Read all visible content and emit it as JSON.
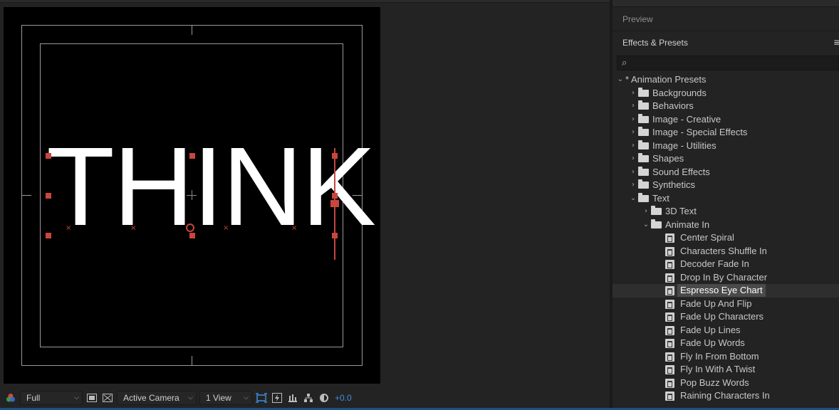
{
  "viewer": {
    "composition_text": "THINK",
    "toolbar": {
      "resolution": "Full",
      "camera": "Active Camera",
      "views": "1 View",
      "exposure": "+0.0"
    }
  },
  "panels": {
    "preview_title": "Preview",
    "effects_title": "Effects & Presets",
    "search_placeholder": ""
  },
  "tree": [
    {
      "label": "* Animation Presets",
      "kind": "root",
      "depth": 0,
      "expanded": true
    },
    {
      "label": "Backgrounds",
      "kind": "folder",
      "depth": 1,
      "expanded": false
    },
    {
      "label": "Behaviors",
      "kind": "folder",
      "depth": 1,
      "expanded": false
    },
    {
      "label": "Image - Creative",
      "kind": "folder",
      "depth": 1,
      "expanded": false
    },
    {
      "label": "Image - Special Effects",
      "kind": "folder",
      "depth": 1,
      "expanded": false
    },
    {
      "label": "Image - Utilities",
      "kind": "folder",
      "depth": 1,
      "expanded": false
    },
    {
      "label": "Shapes",
      "kind": "folder",
      "depth": 1,
      "expanded": false
    },
    {
      "label": "Sound Effects",
      "kind": "folder",
      "depth": 1,
      "expanded": false
    },
    {
      "label": "Synthetics",
      "kind": "folder",
      "depth": 1,
      "expanded": false
    },
    {
      "label": "Text",
      "kind": "folder",
      "depth": 1,
      "expanded": true
    },
    {
      "label": "3D Text",
      "kind": "folder",
      "depth": 2,
      "expanded": false
    },
    {
      "label": "Animate In",
      "kind": "folder",
      "depth": 2,
      "expanded": true
    },
    {
      "label": "Center Spiral",
      "kind": "preset",
      "depth": 3
    },
    {
      "label": "Characters Shuffle In",
      "kind": "preset",
      "depth": 3
    },
    {
      "label": "Decoder Fade In",
      "kind": "preset",
      "depth": 3
    },
    {
      "label": "Drop In By Character",
      "kind": "preset",
      "depth": 3
    },
    {
      "label": "Espresso Eye Chart",
      "kind": "preset",
      "depth": 3,
      "selected": true
    },
    {
      "label": "Fade Up And Flip",
      "kind": "preset",
      "depth": 3
    },
    {
      "label": "Fade Up Characters",
      "kind": "preset",
      "depth": 3
    },
    {
      "label": "Fade Up Lines",
      "kind": "preset",
      "depth": 3
    },
    {
      "label": "Fade Up Words",
      "kind": "preset",
      "depth": 3
    },
    {
      "label": "Fly In From Bottom",
      "kind": "preset",
      "depth": 3
    },
    {
      "label": "Fly In With A Twist",
      "kind": "preset",
      "depth": 3
    },
    {
      "label": "Pop Buzz Words",
      "kind": "preset",
      "depth": 3
    },
    {
      "label": "Raining Characters In",
      "kind": "preset",
      "depth": 3
    }
  ]
}
